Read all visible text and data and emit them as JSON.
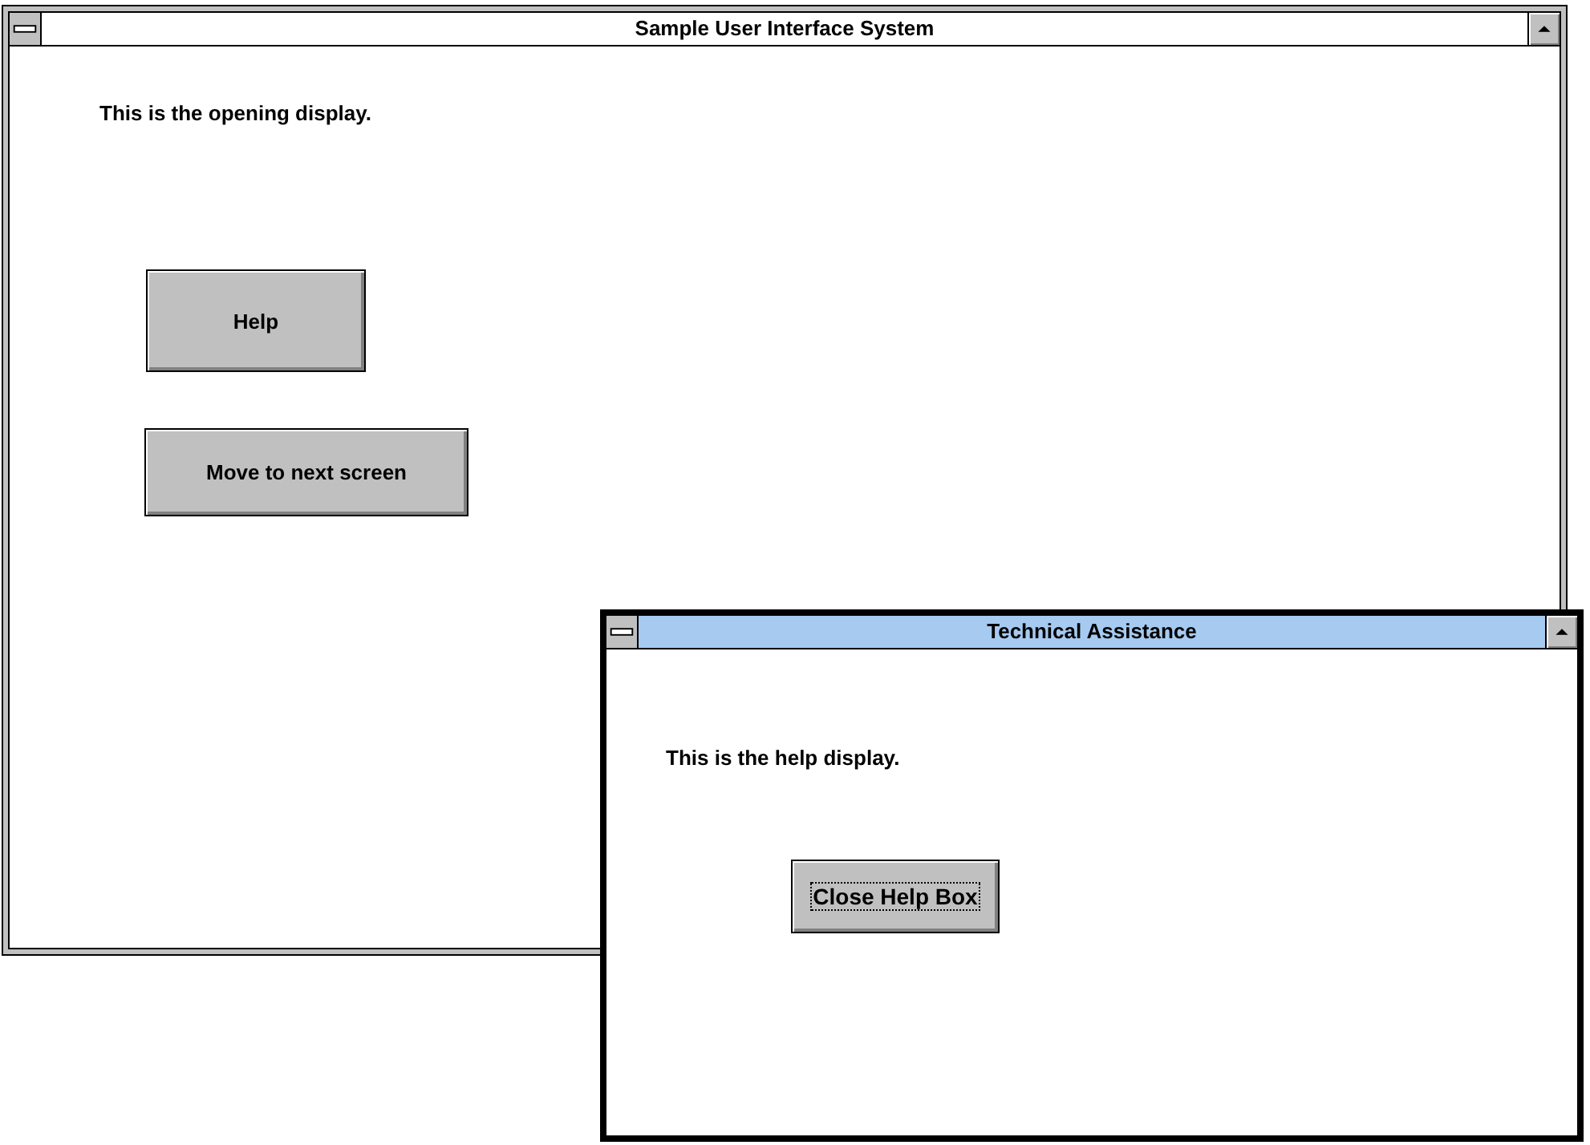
{
  "windows": [
    {
      "title": "Sample User Interface System",
      "active": false,
      "message": "This is the opening display.",
      "buttons": [
        {
          "label": "Help",
          "focused": false
        },
        {
          "label": "Move to next screen",
          "focused": false
        }
      ]
    },
    {
      "title": "Technical Assistance",
      "active": true,
      "message": "This is the help display.",
      "buttons": [
        {
          "label": "Close Help Box",
          "focused": true
        }
      ]
    }
  ]
}
